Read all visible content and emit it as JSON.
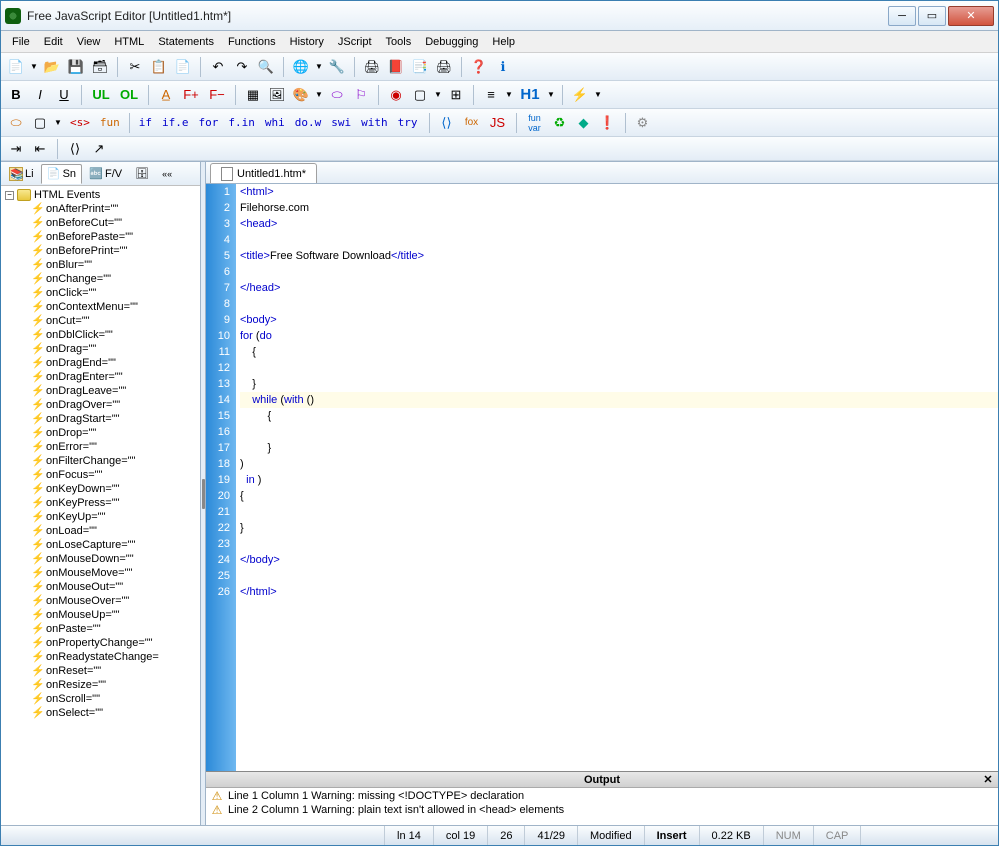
{
  "title": "Free JavaScript Editor      [Untitled1.htm*]",
  "menu": [
    "File",
    "Edit",
    "View",
    "HTML",
    "Statements",
    "Functions",
    "History",
    "JScript",
    "Tools",
    "Debugging",
    "Help"
  ],
  "toolbar3_kw": [
    "<s>",
    "fun",
    "if",
    "if.e",
    "for",
    "f.in",
    "whi",
    "do.w",
    "swi",
    "with",
    "try"
  ],
  "sidebar": {
    "tabs": [
      "Li",
      "Sn",
      "F/V"
    ],
    "root": "HTML Events",
    "items": [
      "onAfterPrint=\"\"",
      "onBeforeCut=\"\"",
      "onBeforePaste=\"\"",
      "onBeforePrint=\"\"",
      "onBlur=\"\"",
      "onChange=\"\"",
      "onClick=\"\"",
      "onContextMenu=\"\"",
      "onCut=\"\"",
      "onDblClick=\"\"",
      "onDrag=\"\"",
      "onDragEnd=\"\"",
      "onDragEnter=\"\"",
      "onDragLeave=\"\"",
      "onDragOver=\"\"",
      "onDragStart=\"\"",
      "onDrop=\"\"",
      "onError=\"\"",
      "onFilterChange=\"\"",
      "onFocus=\"\"",
      "onKeyDown=\"\"",
      "onKeyPress=\"\"",
      "onKeyUp=\"\"",
      "onLoad=\"\"",
      "onLoseCapture=\"\"",
      "onMouseDown=\"\"",
      "onMouseMove=\"\"",
      "onMouseOut=\"\"",
      "onMouseOver=\"\"",
      "onMouseUp=\"\"",
      "onPaste=\"\"",
      "onPropertyChange=\"\"",
      "onReadystateChange=",
      "onReset=\"\"",
      "onResize=\"\"",
      "onScroll=\"\"",
      "onSelect=\"\""
    ]
  },
  "editor": {
    "tab": "Untitled1.htm*",
    "lines": [
      {
        "n": 1,
        "html": "<span class='tag'>&lt;html&gt;</span>"
      },
      {
        "n": 2,
        "html": "Filehorse.com"
      },
      {
        "n": 3,
        "html": "<span class='tag'>&lt;head&gt;</span>"
      },
      {
        "n": 4,
        "html": ""
      },
      {
        "n": 5,
        "html": "<span class='tag'>&lt;title&gt;</span>Free Software Download<span class='tag'>&lt;/title&gt;</span>"
      },
      {
        "n": 6,
        "html": ""
      },
      {
        "n": 7,
        "html": "<span class='tag'>&lt;/head&gt;</span>"
      },
      {
        "n": 8,
        "html": ""
      },
      {
        "n": 9,
        "html": "<span class='tag'>&lt;body&gt;</span>"
      },
      {
        "n": 10,
        "html": "<span class='kw'>for</span> (<span class='kw'>do</span>"
      },
      {
        "n": 11,
        "html": "    {"
      },
      {
        "n": 12,
        "html": ""
      },
      {
        "n": 13,
        "html": "    }"
      },
      {
        "n": 14,
        "html": "    <span class='kw'>while</span> (<span class='kw'>with</span> ()",
        "hl": true
      },
      {
        "n": 15,
        "html": "         {"
      },
      {
        "n": 16,
        "html": ""
      },
      {
        "n": 17,
        "html": "         }"
      },
      {
        "n": 18,
        "html": ")"
      },
      {
        "n": 19,
        "html": "  <span class='kw'>in</span> )"
      },
      {
        "n": 20,
        "html": "{"
      },
      {
        "n": 21,
        "html": ""
      },
      {
        "n": 22,
        "html": "}"
      },
      {
        "n": 23,
        "html": ""
      },
      {
        "n": 24,
        "html": "<span class='tag'>&lt;/body&gt;</span>"
      },
      {
        "n": 25,
        "html": ""
      },
      {
        "n": 26,
        "html": "<span class='tag'>&lt;/html&gt;</span>"
      }
    ]
  },
  "output": {
    "title": "Output",
    "lines": [
      "Line 1 Column 1  Warning: missing <!DOCTYPE> declaration",
      "Line 2 Column 1  Warning: plain text isn't allowed in <head> elements"
    ]
  },
  "status": {
    "ln": "ln 14",
    "col": "col 19",
    "a": "26",
    "b": "41/29",
    "modified": "Modified",
    "insert": "Insert",
    "size": "0.22 KB",
    "num": "NUM",
    "cap": "CAP"
  }
}
